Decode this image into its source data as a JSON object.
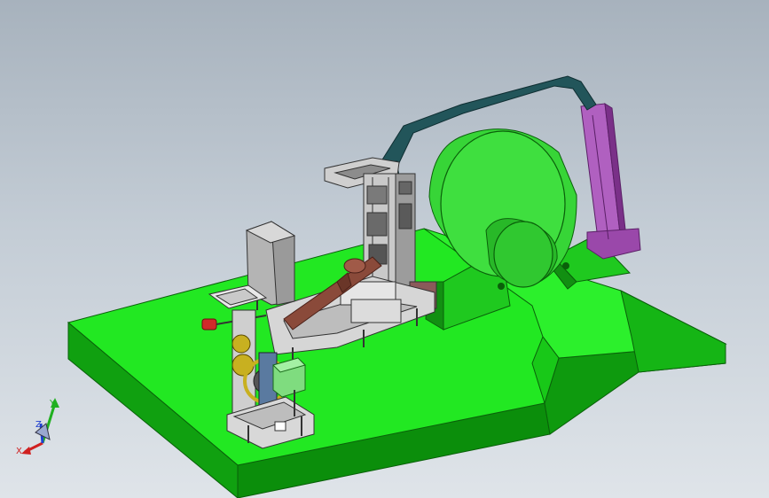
{
  "viewport": {
    "background_top": "#a7b2bd",
    "background_bottom": "#dfe4e9"
  },
  "model": {
    "base_color": "#22e822",
    "drum_color": "#3bdc3b",
    "arch_color": "#22555a",
    "pillar_color": "#a050b0",
    "cabinet_color": "#b8b8b8",
    "shaft_color": "#8a4a3a",
    "gear_color": "#c8b020",
    "small_box_color": "#7fdc7f"
  },
  "triad": {
    "x_label": "X",
    "y_label": "Y",
    "z_label": "Z",
    "x_color": "#d02020",
    "y_color": "#20b020",
    "z_color": "#2040d0"
  }
}
